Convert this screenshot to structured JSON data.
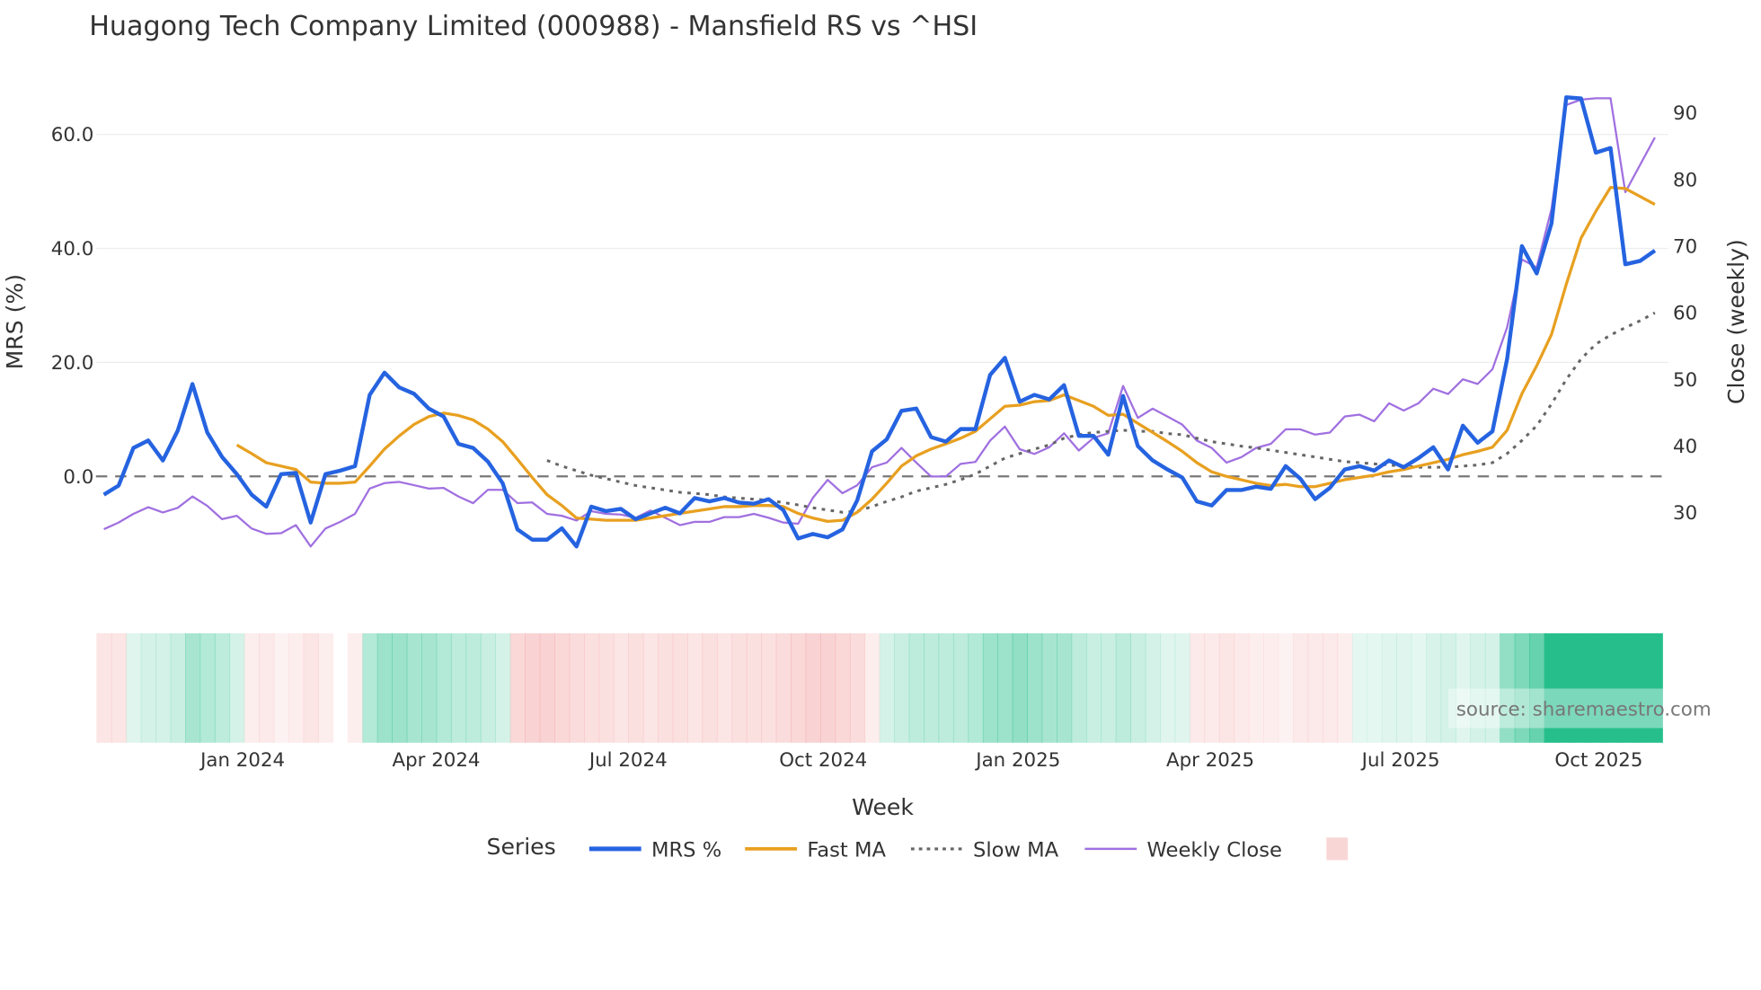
{
  "chart_data": {
    "type": "line",
    "title": "Huagong Tech Company Limited (000988) - Mansfield RS vs ^HSI",
    "xlabel": "Week",
    "ylabel_left": "MRS (%)",
    "ylabel_right": "Close (weekly)",
    "source": "source: sharemaestro.com",
    "legend_title": "Series",
    "legend_position": "bottom-center",
    "grid": true,
    "left_axis": {
      "range": [
        -17,
        72
      ],
      "ticks": [
        0,
        20,
        40,
        60
      ],
      "tick_labels": [
        "0.0",
        "20.0",
        "40.0",
        "60.0"
      ]
    },
    "right_axis": {
      "range": [
        17,
        93
      ],
      "ticks": [
        30,
        40,
        50,
        60,
        70,
        80,
        90
      ],
      "tick_labels": [
        "30",
        "40",
        "50",
        "60",
        "70",
        "80",
        "90"
      ]
    },
    "x_count": 106,
    "x_ticks": [
      {
        "week_index": 9.4,
        "label": "Jan 2024"
      },
      {
        "week_index": 22.5,
        "label": "Apr 2024"
      },
      {
        "week_index": 35.5,
        "label": "Jul 2024"
      },
      {
        "week_index": 48.7,
        "label": "Oct 2024"
      },
      {
        "week_index": 61.9,
        "label": "Jan 2025"
      },
      {
        "week_index": 74.9,
        "label": "Apr 2025"
      },
      {
        "week_index": 87.8,
        "label": "Jul 2025"
      },
      {
        "week_index": 101.2,
        "label": "Oct 2025"
      }
    ],
    "series": [
      {
        "name": "MRS %",
        "axis": "left",
        "color": "#2563e0",
        "style": "solid",
        "start_index": 0,
        "values": [
          -3.2,
          -1.6,
          5,
          6.3,
          2.8,
          8,
          16.2,
          7.7,
          3.4,
          0.4,
          -3.2,
          -5.3,
          0.4,
          0.6,
          -8.1,
          0.4,
          1,
          1.8,
          14.3,
          18.2,
          15.6,
          14.5,
          11.9,
          10.5,
          5.7,
          5,
          2.6,
          -1.2,
          -9.3,
          -11.1,
          -11.1,
          -9.1,
          -12.3,
          -5.3,
          -6.1,
          -5.7,
          -7.5,
          -6.5,
          -5.5,
          -6.5,
          -3.8,
          -4.4,
          -3.8,
          -4.6,
          -4.8,
          -4,
          -5.9,
          -10.9,
          -10.1,
          -10.7,
          -9.3,
          -4.2,
          4.4,
          6.5,
          11.5,
          11.9,
          6.9,
          6.1,
          8.3,
          8.3,
          17.8,
          20.8,
          13.1,
          14.3,
          13.5,
          16,
          7.1,
          7.1,
          3.8,
          14.1,
          5.3,
          2.8,
          1.2,
          -0.2,
          -4.4,
          -5.1,
          -2.4,
          -2.4,
          -1.8,
          -2.2,
          1.8,
          -0.4,
          -4,
          -2,
          1.2,
          1.8,
          1,
          2.8,
          1.6,
          3.2,
          5.1,
          1.2,
          8.9,
          5.9,
          7.9,
          20.6,
          40.4,
          35.6,
          44.4,
          66.5,
          66.3,
          56.8,
          57.6,
          37.2,
          37.8,
          39.6
        ]
      },
      {
        "name": "Fast MA",
        "axis": "left",
        "color": "#e8a020",
        "style": "solid",
        "start_index": 9,
        "values": [
          5.5,
          4,
          2.4,
          1.8,
          1.2,
          -1,
          -1.2,
          -1.2,
          -1,
          1.8,
          4.8,
          7.1,
          9.1,
          10.5,
          11.1,
          10.7,
          9.9,
          8.3,
          6.1,
          3,
          -0.2,
          -3.2,
          -5.1,
          -7.3,
          -7.5,
          -7.7,
          -7.7,
          -7.7,
          -7.3,
          -6.9,
          -6.5,
          -6.1,
          -5.7,
          -5.3,
          -5.3,
          -5.1,
          -5.1,
          -5.3,
          -6.5,
          -7.3,
          -7.9,
          -7.7,
          -6.3,
          -4,
          -1.2,
          1.8,
          3.6,
          4.8,
          5.7,
          6.7,
          7.9,
          10.1,
          12.3,
          12.5,
          13.1,
          13.3,
          14.3,
          13.3,
          12.3,
          10.7,
          10.9,
          9.3,
          7.7,
          6.1,
          4.4,
          2.4,
          0.8,
          0,
          -0.6,
          -1.2,
          -1.6,
          -1.4,
          -1.8,
          -1.8,
          -1.2,
          -0.6,
          -0.2,
          0.2,
          0.8,
          1.2,
          1.8,
          2.4,
          3,
          3.8,
          4.4,
          5.1,
          8.1,
          14.5,
          19.4,
          24.9,
          33.7,
          41.8,
          46.5,
          50.7,
          50.5,
          49.1,
          47.7
        ]
      },
      {
        "name": "Slow MA",
        "axis": "left",
        "color": "#666666",
        "style": "dotted",
        "start_index": 30,
        "values": [
          2.8,
          1.8,
          1,
          0.2,
          -0.4,
          -1,
          -1.6,
          -2,
          -2.4,
          -2.8,
          -3,
          -3.2,
          -3.6,
          -3.8,
          -4,
          -4.2,
          -4.6,
          -5,
          -5.5,
          -5.9,
          -6.3,
          -6.1,
          -5.3,
          -4.4,
          -3.6,
          -2.6,
          -2,
          -1.4,
          -0.6,
          0.4,
          1.8,
          3.2,
          4,
          4.8,
          5.5,
          6.7,
          7.3,
          7.7,
          7.9,
          8.1,
          7.9,
          7.9,
          7.5,
          7.3,
          6.7,
          6.1,
          5.7,
          5.3,
          5,
          4.6,
          4.2,
          3.8,
          3.4,
          3,
          2.6,
          2.4,
          2.2,
          2,
          1.8,
          1.6,
          1.6,
          1.6,
          1.8,
          2,
          2.4,
          4,
          6.3,
          8.9,
          12.7,
          17,
          20.6,
          23.2,
          24.8,
          26.1,
          27.3,
          28.7
        ]
      },
      {
        "name": "Weekly Close",
        "axis": "right",
        "color": "#a070e0",
        "style": "solid",
        "start_index": 0,
        "values": [
          27.5,
          28.5,
          29.8,
          30.8,
          30,
          30.7,
          32.4,
          31,
          29,
          29.5,
          27.6,
          26.8,
          26.9,
          28.1,
          24.9,
          27.6,
          28.6,
          29.8,
          33.6,
          34.4,
          34.6,
          34.1,
          33.6,
          33.7,
          32.4,
          31.4,
          33.4,
          33.4,
          31.4,
          31.5,
          29.8,
          29.5,
          28.8,
          30.2,
          29.8,
          29.7,
          29.2,
          30.3,
          29.2,
          28.1,
          28.6,
          28.6,
          29.3,
          29.3,
          29.8,
          29.2,
          28.5,
          28.3,
          32.2,
          34.9,
          32.9,
          34.1,
          36.8,
          37.5,
          39.7,
          37.5,
          35.4,
          35.4,
          37.3,
          37.6,
          40.8,
          42.9,
          39.5,
          38.8,
          39.8,
          41.9,
          39.3,
          41.2,
          41.9,
          49,
          44.2,
          45.6,
          44.4,
          43.2,
          40.8,
          39.7,
          37.5,
          38.3,
          39.7,
          40.3,
          42.5,
          42.5,
          41.7,
          42,
          44.4,
          44.7,
          43.7,
          46.4,
          45.3,
          46.4,
          48.6,
          47.8,
          50,
          49.3,
          51.5,
          57.8,
          68,
          66.8,
          75.6,
          91.2,
          92,
          92.2,
          92.2,
          78.1,
          82.2,
          86.3
        ]
      }
    ],
    "heatmap": {
      "positive_color": "#26bf8c",
      "negative_color": "#f08a8a",
      "values": [
        -0.3,
        -0.3,
        0.15,
        0.2,
        0.2,
        0.25,
        0.4,
        0.35,
        0.3,
        0.2,
        -0.2,
        -0.25,
        -0.15,
        -0.2,
        -0.3,
        -0.2,
        null,
        -0.2,
        0.35,
        0.45,
        0.45,
        0.4,
        0.4,
        0.35,
        0.3,
        0.3,
        0.25,
        0.2,
        -0.45,
        -0.5,
        -0.5,
        -0.45,
        -0.4,
        -0.35,
        -0.35,
        -0.3,
        -0.35,
        -0.3,
        -0.35,
        -0.35,
        -0.3,
        -0.35,
        -0.3,
        -0.35,
        -0.35,
        -0.35,
        -0.4,
        -0.45,
        -0.5,
        -0.5,
        -0.45,
        -0.4,
        -0.2,
        0.2,
        0.25,
        0.3,
        0.3,
        0.3,
        0.3,
        0.35,
        0.45,
        0.45,
        0.5,
        0.45,
        0.4,
        0.4,
        0.3,
        0.25,
        0.25,
        0.3,
        0.25,
        0.2,
        0.15,
        0.15,
        -0.25,
        -0.25,
        -0.3,
        -0.25,
        -0.2,
        -0.2,
        -0.15,
        -0.25,
        -0.25,
        -0.25,
        -0.2,
        0.12,
        0.12,
        0.15,
        0.15,
        0.12,
        0.18,
        0.2,
        0.15,
        0.2,
        0.2,
        0.5,
        0.6,
        0.7,
        1,
        1,
        1,
        1,
        1,
        1,
        1,
        1
      ]
    }
  }
}
